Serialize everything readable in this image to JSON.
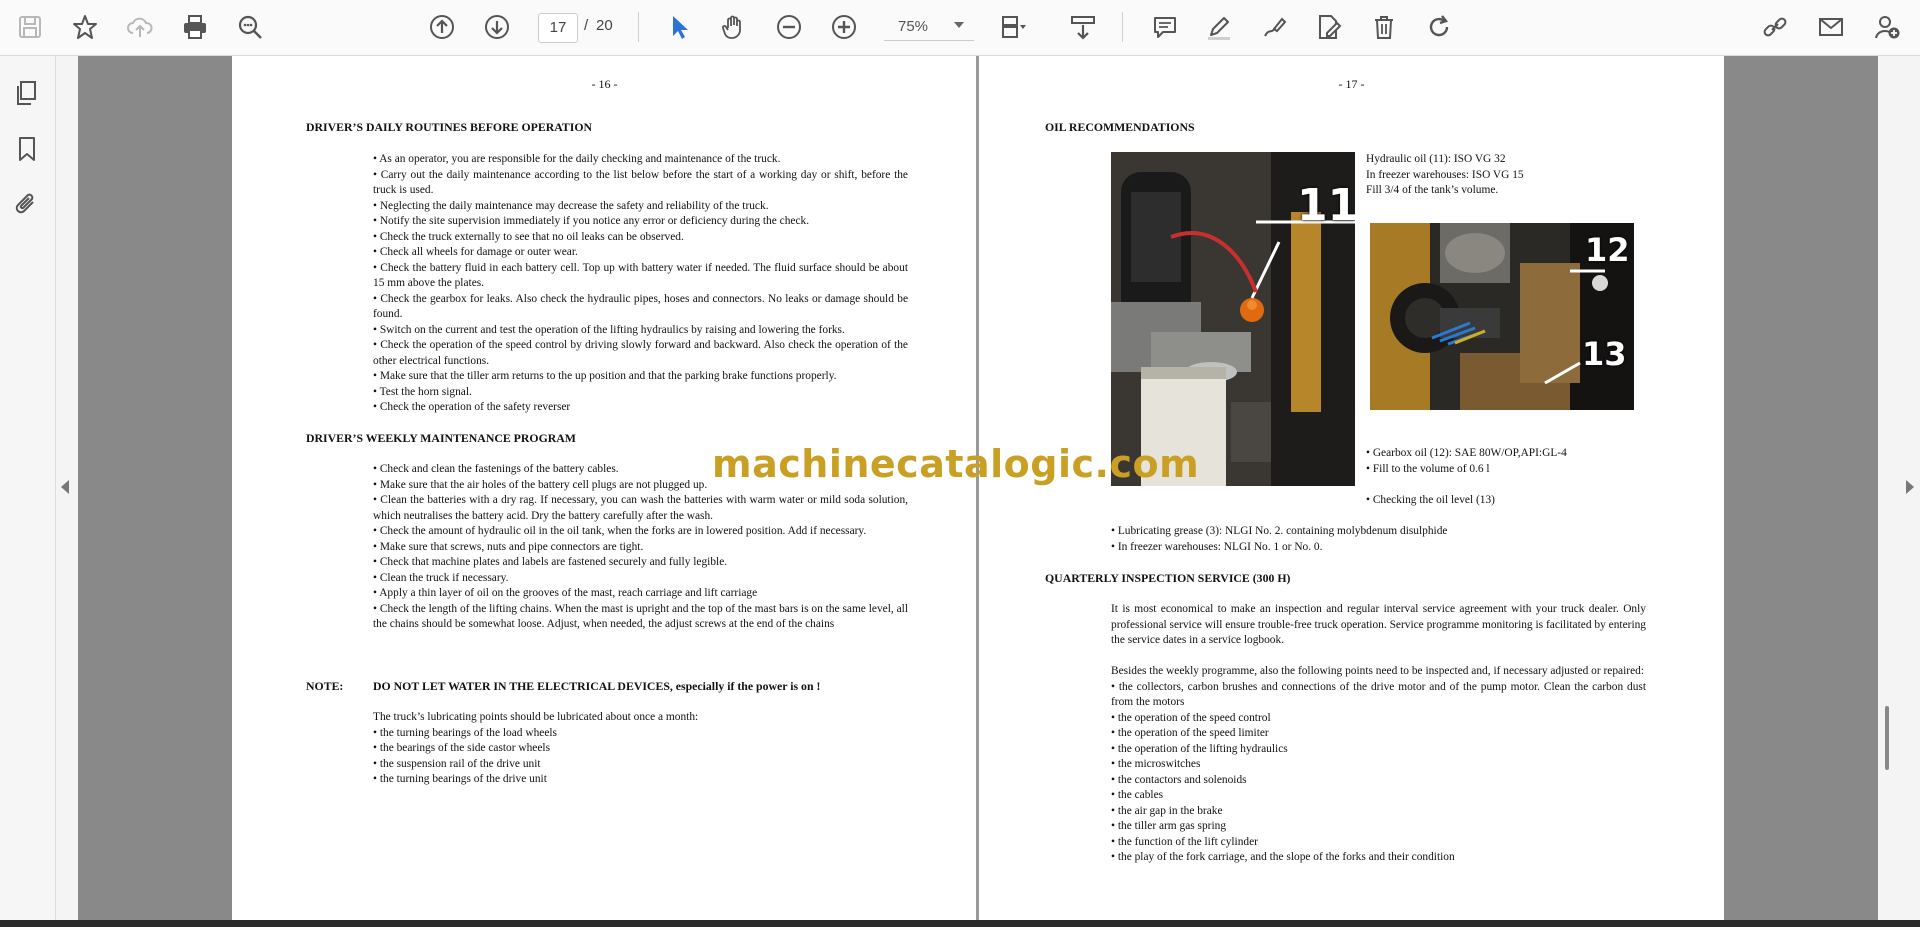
{
  "toolbar": {
    "page_current": "17",
    "page_separator": "/",
    "page_total": "20",
    "zoom_level": "75%"
  },
  "watermark": "machinecatalogic.com",
  "page16": {
    "page_number": "- 16 -",
    "section1_title": "DRIVER’S DAILY ROUTINES BEFORE OPERATION",
    "section1_items": [
      "• As an operator, you are responsible for the daily checking and maintenance of the truck.",
      "• Carry out the daily maintenance according to the list below before the start of a working day or shift, before the truck is used.",
      "• Neglecting the daily maintenance may decrease the safety and reliability of the truck.",
      "• Notify the site supervision immediately if you notice any error or deficiency during the check.",
      "• Check the truck externally to see that no oil leaks can be observed.",
      "• Check all wheels for damage or outer wear.",
      "• Check the battery fluid in each battery cell. Top up with battery water if needed. The fluid surface should be about 15 mm above the plates.",
      "• Check the gearbox for leaks. Also check the hydraulic pipes, hoses and connectors. No leaks or damage should be found.",
      "• Switch on the current and test the operation of the lifting hydraulics by raising and lowering the forks.",
      "• Check the operation of the speed control by driving slowly forward and backward. Also check the operation of the other electrical functions.",
      "• Make sure that the tiller arm returns to the up position and that the parking brake functions properly.",
      "• Test the horn signal.",
      "• Check the operation of the safety reverser"
    ],
    "section2_title": "DRIVER’S WEEKLY MAINTENANCE PROGRAM",
    "section2_items": [
      "• Check and clean the fastenings of the battery cables.",
      "• Make sure that the air holes of the battery cell plugs are not plugged up.",
      "• Clean the batteries with a dry rag. If necessary, you can wash the batteries with warm water or mild soda solution, which neutralises the battery acid. Dry the battery carefully after the wash.",
      "• Check the amount of hydraulic oil in the oil tank, when the forks are in lowered position. Add if necessary.",
      "• Make sure that screws, nuts and pipe connectors are tight.",
      "• Check that machine plates and labels are fastened securely and fully legible.",
      "• Clean the truck if necessary.",
      "• Apply a thin layer of oil on the grooves of the mast, reach carriage and lift carriage",
      "• Check the length of the lifting chains.  When the mast is upright and the top of the mast bars is on the same level, all the chains should be somewhat loose.  Adjust, when needed, the adjust screws at the end of the chains"
    ],
    "note_label": "NOTE:",
    "note_text": "DO NOT LET WATER IN THE ELECTRICAL DEVICES, especially if the power is on !",
    "lube_intro": "The truck’s lubricating points should be lubricated about once a month:",
    "lube_items": [
      "• the turning bearings of the load wheels",
      "• the bearings of the side castor wheels",
      "• the suspension rail of the drive unit",
      "• the turning bearings of the drive unit"
    ]
  },
  "page17": {
    "page_number": "- 17 -",
    "oil_title": "OIL RECOMMENDATIONS",
    "photo1_label": "11",
    "photo2_label_a": "12",
    "photo2_label_b": "13",
    "hydraulic_lines": [
      "Hydraulic oil (11): ISO VG 32",
      "In freezer warehouses:  ISO VG 15",
      "Fill 3/4 of the tank’s volume."
    ],
    "gearbox_lines": [
      "• Gearbox oil (12): SAE 80W/OP,API:GL-4",
      "• Fill to the volume of 0.6 l"
    ],
    "check_level": "• Checking the oil level (13)",
    "grease_lines": [
      "• Lubricating grease (3): NLGI  No. 2. containing molybdenum disulphide",
      "• In freezer warehouses: NLGI No. 1 or No. 0."
    ],
    "quarterly_title": "QUARTERLY INSPECTION SERVICE (300 H)",
    "quarterly_para1": "It is most economical to make an inspection and regular interval service agreement with your truck dealer. Only professional service will ensure trouble-free truck operation. Service programme monitoring is facilitated by entering the service dates in a service logbook.",
    "quarterly_para2": "Besides the weekly programme, also the following points need to be inspected and, if necessary adjusted or repaired:",
    "quarterly_items": [
      "• the collectors, carbon brushes and connections of the drive motor and of the pump motor. Clean the carbon dust from the motors",
      "• the operation of the speed control",
      "• the operation of the speed limiter",
      "• the operation of the lifting hydraulics",
      "• the microswitches",
      "• the contactors and solenoids",
      "• the cables",
      "• the air gap in the brake",
      "• the tiller arm gas spring",
      "• the function of the lift cylinder",
      "• the play of the fork carriage, and the slope of the forks and their condition"
    ]
  }
}
